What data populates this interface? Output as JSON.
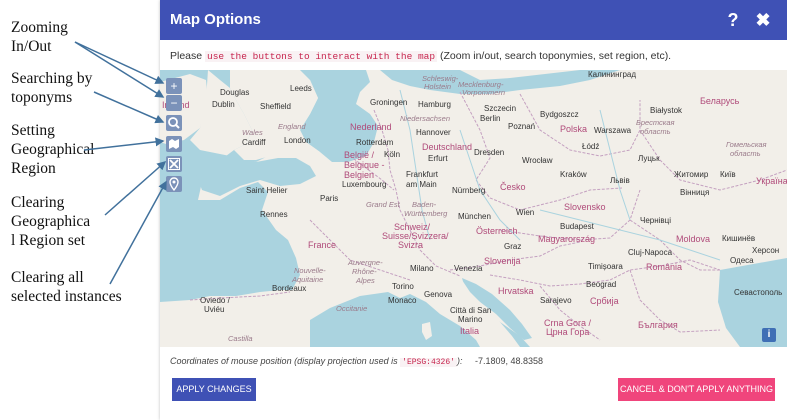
{
  "annotations": [
    {
      "lines": [
        "Zooming",
        "In/Out"
      ]
    },
    {
      "lines": [
        "Searching by",
        "toponyms"
      ]
    },
    {
      "lines": [
        "Setting",
        "Geographical",
        "Region"
      ]
    },
    {
      "lines": [
        "Clearing",
        "Geographica",
        "l Region set"
      ]
    },
    {
      "lines": [
        "Clearing all",
        "selected instances"
      ]
    }
  ],
  "dialog": {
    "title": "Map Options",
    "help_icon": "?",
    "close_icon": "✖",
    "instructions_prefix": "Please",
    "instructions_code": "use the buttons to interact with the map",
    "instructions_suffix": "(Zoom in/out, search toponymies, set region, etc)."
  },
  "map": {
    "controls": [
      {
        "name": "zoom-in-button",
        "glyph": "+"
      },
      {
        "name": "zoom-out-button",
        "glyph": "−"
      },
      {
        "name": "search-toponym-button",
        "icon": "search-icon"
      },
      {
        "name": "set-region-button",
        "icon": "region-icon"
      },
      {
        "name": "clear-region-button",
        "icon": "clear-region-icon"
      },
      {
        "name": "clear-all-button",
        "icon": "map-pin-icon"
      }
    ],
    "info_label": "i",
    "places": {
      "douglas": "Douglas",
      "leeds": "Leeds",
      "dublin": "Dublin",
      "ireland": "Ireland",
      "sheffield": "Sheffield",
      "england": "England",
      "wales": "Wales",
      "cardiff": "Cardiff",
      "london": "London",
      "groningen": "Groningen",
      "hamburg": "Hamburg",
      "szczecin": "Szczecin",
      "bialystok": "Białystok",
      "nederland": "Nederland",
      "niedersachsen": "Niedersachsen",
      "berlin": "Berlin",
      "bydgoszcz": "Bydgoszcz",
      "hannover": "Hannover",
      "poznan": "Poznań",
      "polska": "Polska",
      "warszawa": "Warszawa",
      "rotterdam": "Rotterdam",
      "deutschland": "Deutschland",
      "belgie": "België /",
      "belgique": "Belgique -",
      "belgien": "Belgien",
      "koln": "Köln",
      "erfurt": "Erfurt",
      "dresden": "Dresden",
      "lodz": "Łódź",
      "wroclaw": "Wrocław",
      "luxembourg": "Luxembourg",
      "frankfurt": "Frankfurt",
      "am_main": "am Main",
      "cesko": "Česko",
      "krakow": "Kraków",
      "saint_helier": "Saint Helier",
      "paris": "Paris",
      "nurnberg": "Nürnberg",
      "rennes": "Rennes",
      "grand_est": "Grand Est",
      "baden": "Baden-",
      "wurttemberg": "Württemberg",
      "munchen": "München",
      "wien": "Wien",
      "slovensko": "Slovensko",
      "france": "France",
      "schweiz": "Schweiz/",
      "suisse": "Suisse/Svizzera/",
      "svizra": "Svizra",
      "osterreich": "Österreich",
      "graz": "Graz",
      "magyarorszag": "Magyarország",
      "budapest": "Budapest",
      "moldova": "Moldova",
      "nouvelle": "Nouvelle-",
      "aquitaine": "Aquitaine",
      "auvergne": "Auvergne-",
      "rhone": "Rhône-",
      "alpes": "Alpes",
      "milano": "Milano",
      "venezia": "Venezia",
      "slovenija": "Slovenija",
      "timisoara": "Timișoara",
      "cluj": "Cluj-Napoca",
      "romania": "România",
      "bordeaux": "Bordeaux",
      "hrvatska": "Hrvatska",
      "beograd": "Beograd",
      "monaco": "Monaco",
      "torino": "Torino",
      "genova": "Genova",
      "sarajevo": "Sarajevo",
      "srbija": "Србија",
      "occitanie": "Occitanie",
      "oviedo1": "Oviedo /",
      "oviedo2": "Uviéu",
      "citta1": "Città di San",
      "citta2": "Marino",
      "italia": "Italia",
      "crna1": "Crna Gora /",
      "crna2": "Црна Гора",
      "bulgaria": "България",
      "castilla": "Castilla",
      "kaliningrad": "Калининград",
      "belarus": "Беларусь",
      "brest1": "Брестская",
      "brest2": "область",
      "gomel1": "Гомельская",
      "gomel2": "область",
      "lutsk": "Луцьк",
      "zhytomyr": "Житомир",
      "kyiv": "Київ",
      "lviv": "Львів",
      "ukraina": "Україна",
      "vinnytsia": "Вінниця",
      "chernivtsi": "Чернівці",
      "kherson": "Херсон",
      "chisinau": "Кишинёв",
      "odesa": "Одеса",
      "sevastopol": "Севастополь",
      "schleswig": "Schleswig-",
      "holstein": "Holstein",
      "mecklenburg": "Mecklenburg-",
      "vorpommern": "Vorpommern"
    }
  },
  "coords": {
    "label": "Coordinates of mouse position (display projection used is",
    "projection": "'EPSG:4326'",
    "suffix": "):",
    "value": "-7.1809, 48.8358"
  },
  "buttons": {
    "apply": "APPLY CHANGES",
    "cancel": "CANCEL & DON'T APPLY ANYTHING"
  },
  "colors": {
    "header": "#3f51b5",
    "apply": "#3f51b5",
    "cancel": "#f0457c",
    "water": "#aad3df",
    "land": "#f2efe9"
  }
}
